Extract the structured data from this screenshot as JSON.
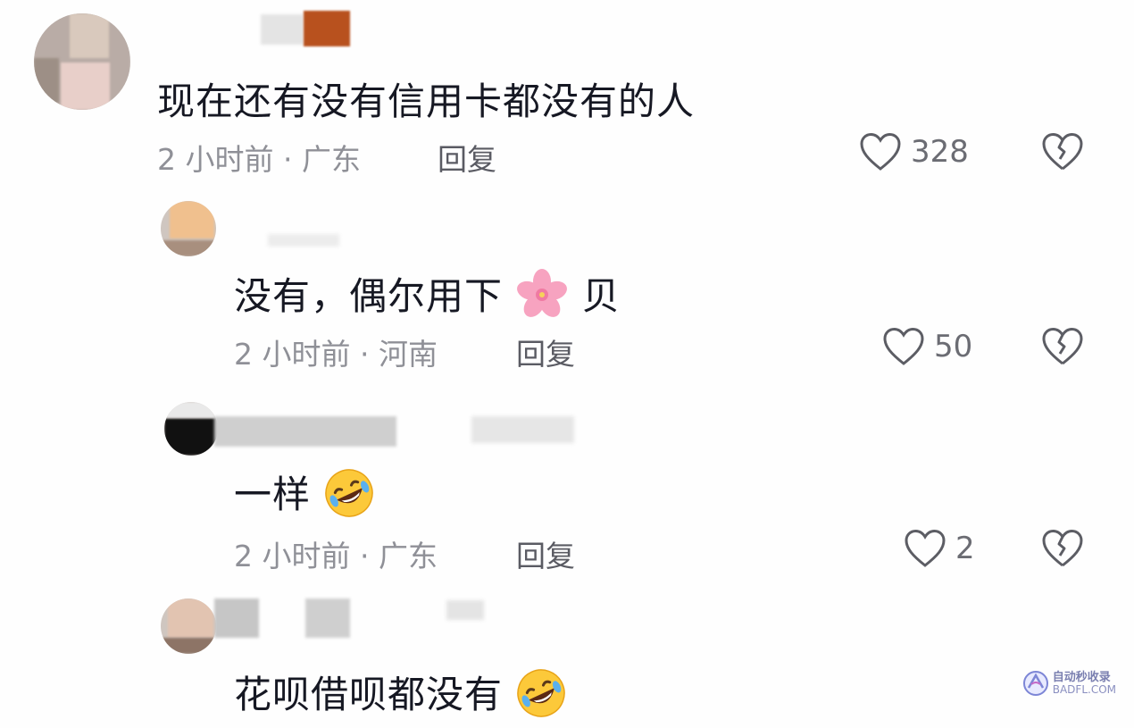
{
  "comments": [
    {
      "text": "现在还有没有信用卡都没有的人",
      "meta": "2 小时前 · 广东",
      "reply_label": "回复",
      "likes": "328"
    },
    {
      "text": "没有，偶尔用下",
      "text_after_emoji": "贝",
      "emoji": "cherry-blossom",
      "meta": "2 小时前 · 河南",
      "reply_label": "回复",
      "likes": "50"
    },
    {
      "text": "一样",
      "emoji": "rolling-laughing",
      "meta": "2 小时前 · 广东",
      "reply_label": "回复",
      "likes": "2"
    },
    {
      "text": "花呗借呗都没有",
      "emoji": "rolling-laughing"
    }
  ],
  "watermark": {
    "line1": "自动秒收录",
    "line2": "BADFL.COM"
  },
  "icons": {
    "like": "heart-outline-icon",
    "dislike": "broken-heart-icon"
  }
}
